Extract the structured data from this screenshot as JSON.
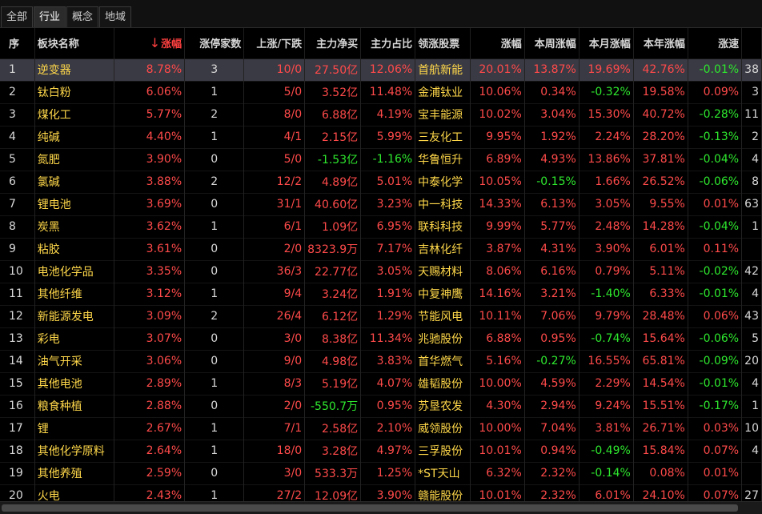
{
  "tabs": [
    "全部",
    "行业",
    "概念",
    "地域"
  ],
  "active_tab": 1,
  "columns": [
    "序",
    "板块名称",
    "涨幅",
    "涨停家数",
    "上涨/下跌",
    "主力净买",
    "主力占比",
    "领涨股票",
    "涨幅",
    "本周涨幅",
    "本月涨幅",
    "本年涨幅",
    "涨速"
  ],
  "sort_arrow": "↓",
  "rows": [
    {
      "idx": "1",
      "name": "逆变器",
      "chg": "8.78%",
      "limit": "3",
      "updown": "10/0",
      "netbuy": "27.50亿",
      "ratio": "12.06%",
      "lead": "首航新能",
      "lchg": "20.01%",
      "week": "13.87%",
      "month": "19.69%",
      "year": "42.76%",
      "speed": "-0.01%",
      "extra": "38"
    },
    {
      "idx": "2",
      "name": "钛白粉",
      "chg": "6.06%",
      "limit": "1",
      "updown": "5/0",
      "netbuy": "3.52亿",
      "ratio": "11.48%",
      "lead": "金浦钛业",
      "lchg": "10.06%",
      "week": "0.34%",
      "month": "-0.32%",
      "year": "19.58%",
      "speed": "0.09%",
      "extra": "3"
    },
    {
      "idx": "3",
      "name": "煤化工",
      "chg": "5.77%",
      "limit": "2",
      "updown": "8/0",
      "netbuy": "6.88亿",
      "ratio": "4.19%",
      "lead": "宝丰能源",
      "lchg": "10.02%",
      "week": "3.04%",
      "month": "15.30%",
      "year": "40.72%",
      "speed": "-0.28%",
      "extra": "11"
    },
    {
      "idx": "4",
      "name": "纯碱",
      "chg": "4.40%",
      "limit": "1",
      "updown": "4/1",
      "netbuy": "2.15亿",
      "ratio": "5.99%",
      "lead": "三友化工",
      "lchg": "9.95%",
      "week": "1.92%",
      "month": "2.24%",
      "year": "28.20%",
      "speed": "-0.13%",
      "extra": "2"
    },
    {
      "idx": "5",
      "name": "氮肥",
      "chg": "3.90%",
      "limit": "0",
      "updown": "5/0",
      "netbuy": "-1.53亿",
      "ratio": "-1.16%",
      "lead": "华鲁恒升",
      "lchg": "6.89%",
      "week": "4.93%",
      "month": "13.86%",
      "year": "37.81%",
      "speed": "-0.04%",
      "extra": "4"
    },
    {
      "idx": "6",
      "name": "氯碱",
      "chg": "3.88%",
      "limit": "2",
      "updown": "12/2",
      "netbuy": "4.89亿",
      "ratio": "5.01%",
      "lead": "中泰化学",
      "lchg": "10.05%",
      "week": "-0.15%",
      "month": "1.66%",
      "year": "26.52%",
      "speed": "-0.06%",
      "extra": "8"
    },
    {
      "idx": "7",
      "name": "锂电池",
      "chg": "3.69%",
      "limit": "0",
      "updown": "31/1",
      "netbuy": "40.60亿",
      "ratio": "3.23%",
      "lead": "中一科技",
      "lchg": "14.33%",
      "week": "6.13%",
      "month": "3.05%",
      "year": "9.55%",
      "speed": "0.01%",
      "extra": "63"
    },
    {
      "idx": "8",
      "name": "炭黑",
      "chg": "3.62%",
      "limit": "1",
      "updown": "6/1",
      "netbuy": "1.09亿",
      "ratio": "6.95%",
      "lead": "联科科技",
      "lchg": "9.99%",
      "week": "5.77%",
      "month": "2.48%",
      "year": "14.28%",
      "speed": "-0.04%",
      "extra": "1"
    },
    {
      "idx": "9",
      "name": "粘胶",
      "chg": "3.61%",
      "limit": "0",
      "updown": "2/0",
      "netbuy": "8323.9万",
      "ratio": "7.17%",
      "lead": "吉林化纤",
      "lchg": "3.87%",
      "week": "4.31%",
      "month": "3.90%",
      "year": "6.01%",
      "speed": "0.11%",
      "extra": ""
    },
    {
      "idx": "10",
      "name": "电池化学品",
      "chg": "3.35%",
      "limit": "0",
      "updown": "36/3",
      "netbuy": "22.77亿",
      "ratio": "3.05%",
      "lead": "天赐材料",
      "lchg": "8.06%",
      "week": "6.16%",
      "month": "0.79%",
      "year": "5.11%",
      "speed": "-0.02%",
      "extra": "42"
    },
    {
      "idx": "11",
      "name": "其他纤维",
      "chg": "3.12%",
      "limit": "1",
      "updown": "9/4",
      "netbuy": "3.24亿",
      "ratio": "1.91%",
      "lead": "中复神鹰",
      "lchg": "14.16%",
      "week": "3.21%",
      "month": "-1.40%",
      "year": "6.33%",
      "speed": "-0.01%",
      "extra": "4"
    },
    {
      "idx": "12",
      "name": "新能源发电",
      "chg": "3.09%",
      "limit": "2",
      "updown": "26/4",
      "netbuy": "6.12亿",
      "ratio": "1.29%",
      "lead": "节能风电",
      "lchg": "10.11%",
      "week": "7.06%",
      "month": "9.79%",
      "year": "28.48%",
      "speed": "0.06%",
      "extra": "43"
    },
    {
      "idx": "13",
      "name": "彩电",
      "chg": "3.07%",
      "limit": "0",
      "updown": "3/0",
      "netbuy": "8.38亿",
      "ratio": "11.34%",
      "lead": "兆驰股份",
      "lchg": "6.88%",
      "week": "0.95%",
      "month": "-0.74%",
      "year": "15.64%",
      "speed": "-0.06%",
      "extra": "5"
    },
    {
      "idx": "14",
      "name": "油气开采",
      "chg": "3.06%",
      "limit": "0",
      "updown": "9/0",
      "netbuy": "4.98亿",
      "ratio": "3.83%",
      "lead": "首华燃气",
      "lchg": "5.16%",
      "week": "-0.27%",
      "month": "16.55%",
      "year": "65.81%",
      "speed": "-0.09%",
      "extra": "20"
    },
    {
      "idx": "15",
      "name": "其他电池",
      "chg": "2.89%",
      "limit": "1",
      "updown": "8/3",
      "netbuy": "5.19亿",
      "ratio": "4.07%",
      "lead": "雄韬股份",
      "lchg": "10.00%",
      "week": "4.59%",
      "month": "2.29%",
      "year": "14.54%",
      "speed": "-0.01%",
      "extra": "4"
    },
    {
      "idx": "16",
      "name": "粮食种植",
      "chg": "2.88%",
      "limit": "0",
      "updown": "2/0",
      "netbuy": "-550.7万",
      "ratio": "0.95%",
      "lead": "苏垦农发",
      "lchg": "4.30%",
      "week": "2.94%",
      "month": "9.24%",
      "year": "15.51%",
      "speed": "-0.17%",
      "extra": "1"
    },
    {
      "idx": "17",
      "name": "锂",
      "chg": "2.67%",
      "limit": "1",
      "updown": "7/1",
      "netbuy": "2.58亿",
      "ratio": "2.10%",
      "lead": "威领股份",
      "lchg": "10.00%",
      "week": "7.04%",
      "month": "3.81%",
      "year": "26.71%",
      "speed": "0.03%",
      "extra": "10"
    },
    {
      "idx": "18",
      "name": "其他化学原料",
      "chg": "2.64%",
      "limit": "1",
      "updown": "18/0",
      "netbuy": "3.28亿",
      "ratio": "4.97%",
      "lead": "三孚股份",
      "lchg": "10.01%",
      "week": "0.94%",
      "month": "-0.49%",
      "year": "15.84%",
      "speed": "0.07%",
      "extra": "4"
    },
    {
      "idx": "19",
      "name": "其他养殖",
      "chg": "2.59%",
      "limit": "0",
      "updown": "3/0",
      "netbuy": "533.3万",
      "ratio": "1.25%",
      "lead": "*ST天山",
      "lchg": "6.32%",
      "week": "2.32%",
      "month": "-0.14%",
      "year": "0.08%",
      "speed": "0.01%",
      "extra": ""
    },
    {
      "idx": "20",
      "name": "火电",
      "chg": "2.43%",
      "limit": "1",
      "updown": "27/2",
      "netbuy": "12.09亿",
      "ratio": "3.90%",
      "lead": "赣能股份",
      "lchg": "10.01%",
      "week": "2.32%",
      "month": "6.01%",
      "year": "24.10%",
      "speed": "0.07%",
      "extra": "27"
    }
  ]
}
